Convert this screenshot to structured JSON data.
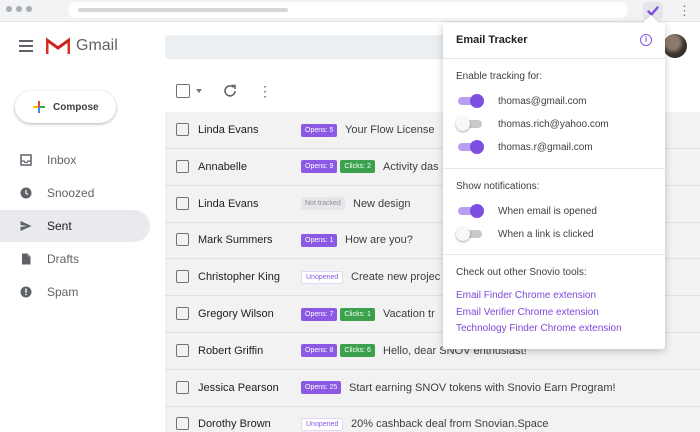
{
  "gmail": {
    "brand": "Gmail",
    "compose_label": "Compose",
    "nav": [
      {
        "label": "Inbox"
      },
      {
        "label": "Snoozed"
      },
      {
        "label": "Sent"
      },
      {
        "label": "Drafts"
      },
      {
        "label": "Spam"
      }
    ],
    "active_nav": "Sent"
  },
  "mails": [
    {
      "sender": "Linda Evans",
      "badges": [
        {
          "type": "opens",
          "text": "Opens: 5"
        }
      ],
      "subject": "Your Flow License"
    },
    {
      "sender": "Annabelle",
      "badges": [
        {
          "type": "opens",
          "text": "Opens: 9"
        },
        {
          "type": "clicks",
          "text": "Clicks: 2"
        }
      ],
      "subject": "Activity das"
    },
    {
      "sender": "Linda Evans",
      "badges": [
        {
          "type": "not-tracked",
          "text": "Not tracked"
        }
      ],
      "subject": "New design"
    },
    {
      "sender": "Mark Summers",
      "badges": [
        {
          "type": "opens",
          "text": "Opens: 1"
        }
      ],
      "subject": "How are you?"
    },
    {
      "sender": "Christopher King",
      "badges": [
        {
          "type": "unopened",
          "text": "Unopened"
        }
      ],
      "subject": "Create new projec"
    },
    {
      "sender": "Gregory Wilson",
      "badges": [
        {
          "type": "opens",
          "text": "Opens: 7"
        },
        {
          "type": "clicks",
          "text": "Clicks: 1"
        }
      ],
      "subject": "Vacation tr"
    },
    {
      "sender": "Robert Griffin",
      "badges": [
        {
          "type": "opens",
          "text": "Opens: 8"
        },
        {
          "type": "clicks",
          "text": "Clicks: 6"
        }
      ],
      "subject": "Hello, dear SNOV enthusiast!"
    },
    {
      "sender": "Jessica Pearson",
      "badges": [
        {
          "type": "opens",
          "text": "Opens: 25"
        }
      ],
      "subject": "Start earning SNOV tokens with Snovio Earn Program!"
    },
    {
      "sender": "Dorothy Brown",
      "badges": [
        {
          "type": "unopened",
          "text": "Unopened"
        }
      ],
      "subject": "20% cashback deal from Snovian.Space"
    }
  ],
  "popup": {
    "title": "Email Tracker",
    "info_icon": "i",
    "tracking_heading": "Enable tracking for:",
    "accounts": [
      {
        "email": "thomas@gmail.com",
        "enabled": true
      },
      {
        "email": "thomas.rich@yahoo.com",
        "enabled": false
      },
      {
        "email": "thomas.r@gmail.com",
        "enabled": true
      }
    ],
    "notifications_heading": "Show notifications:",
    "notifications": [
      {
        "label": "When email is opened",
        "enabled": true
      },
      {
        "label": "When a link is clicked",
        "enabled": false
      }
    ],
    "tools_heading": "Check out other Snovio tools:",
    "tools": [
      {
        "label": "Email Finder Chrome extension"
      },
      {
        "label": "Email Verifier Chrome extension"
      },
      {
        "label": "Technology Finder Chrome extension"
      }
    ]
  },
  "colors": {
    "accent": "#7e4ee0",
    "opens_badge": "#8b59e4",
    "clicks_badge": "#3ca14c",
    "link": "#7b4ad8"
  },
  "icons": [
    "checkmark-icon",
    "more-vert-icon",
    "menu-icon",
    "gmail-logo-icon",
    "refresh-icon",
    "inbox-icon",
    "clock-icon",
    "send-icon",
    "file-icon",
    "alert-icon",
    "info-icon"
  ]
}
